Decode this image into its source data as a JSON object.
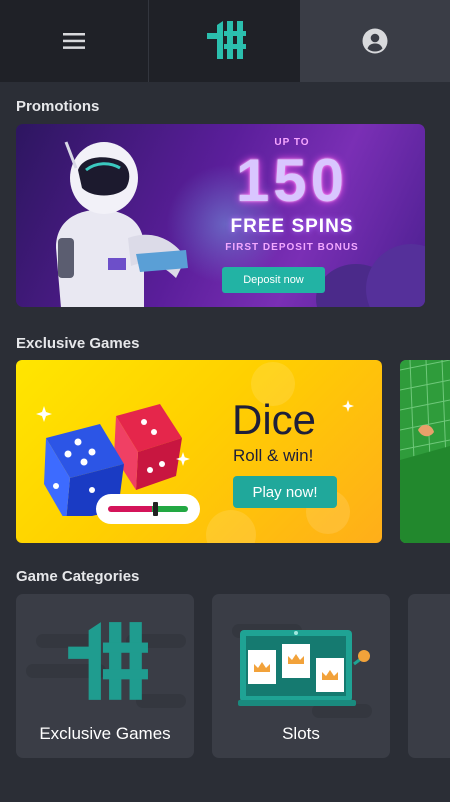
{
  "topbar": {
    "menu_icon": "hamburger-menu-icon",
    "logo": "hashtag-logo",
    "account_icon": "user-account-icon"
  },
  "promotions": {
    "section_title": "Promotions",
    "banner": {
      "up_to": "UP TO",
      "amount": "150",
      "headline": "FREE SPINS",
      "subline": "FIRST DEPOSIT BONUS",
      "button_label": "Deposit now"
    }
  },
  "exclusive_games": {
    "section_title": "Exclusive Games",
    "cards": [
      {
        "title": "Dice",
        "subtitle": "Roll & win!",
        "button_label": "Play now!"
      }
    ]
  },
  "game_categories": {
    "section_title": "Game Categories",
    "items": [
      {
        "label": "Exclusive Games",
        "icon": "hashtag-logo-icon"
      },
      {
        "label": "Slots",
        "icon": "slot-machine-icon"
      }
    ]
  },
  "colors": {
    "accent": "#22b3a4",
    "background": "#2b2e36",
    "topbar": "#1f2127",
    "card": "#3a3d46"
  }
}
